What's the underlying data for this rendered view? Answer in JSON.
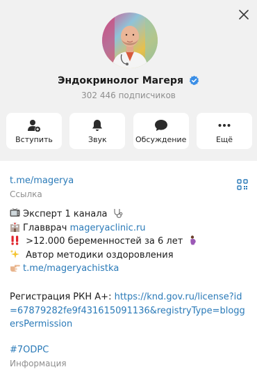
{
  "channel": {
    "title": "Эндокринолог Магеря",
    "subscribers": "302 446 подписчиков"
  },
  "actions": [
    {
      "label": "Вступить",
      "icon": "join-user-icon"
    },
    {
      "label": "Звук",
      "icon": "bell-icon"
    },
    {
      "label": "Обсуждение",
      "icon": "chat-bubble-icon"
    },
    {
      "label": "Ещё",
      "icon": "more-dots-icon"
    }
  ],
  "link": {
    "url": "t.me/magerya",
    "caption": "Ссылка"
  },
  "description": {
    "line1": "Эксперт 1 канала",
    "line2_prefix": "Главврач ",
    "line2_link": "mageryaclinic.ru",
    "line3": " >12.000 беременностей за 6 лет",
    "line4": " Автор методики оздоровления",
    "line5_link": "t.me/mageryachistka"
  },
  "registration": {
    "prefix": "Регистрация РКН А+: ",
    "link": "https://knd.gov.ru/license?id=67879282fe9f431615091136&registryType=bloggersPermission"
  },
  "info": {
    "hashtag": "#7ODPC",
    "caption": "Информация"
  },
  "colors": {
    "accent": "#2a7ab8",
    "verified": "#3a8ee6",
    "background": "#f1f1f1"
  }
}
